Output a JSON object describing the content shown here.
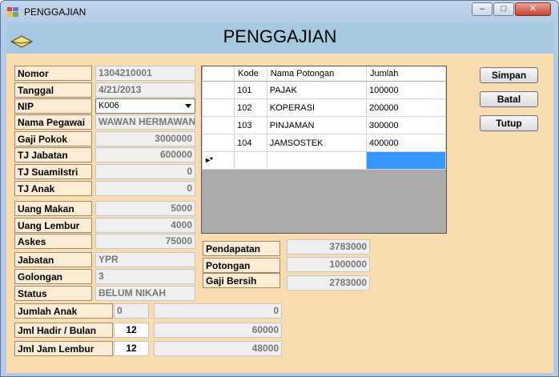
{
  "window": {
    "title": "PENGGAJIAN"
  },
  "form": {
    "heading": "PENGGAJIAN"
  },
  "fields": {
    "nomor": {
      "label": "Nomor",
      "value": "1304210001"
    },
    "tanggal": {
      "label": "Tanggal",
      "value": "4/21/2013"
    },
    "nip": {
      "label": "NIP",
      "value": "K006"
    },
    "nama_pegawai": {
      "label": "Nama Pegawai",
      "value": "WAWAN HERMAWAN"
    },
    "gaji_pokok": {
      "label": "Gaji Pokok",
      "value": "3000000"
    },
    "tj_jabatan": {
      "label": "TJ Jabatan",
      "value": "600000"
    },
    "tj_suamiistri": {
      "label": "TJ SuamiIstri",
      "value": "0"
    },
    "tj_anak": {
      "label": "TJ Anak",
      "value": "0"
    },
    "uang_makan": {
      "label": "Uang Makan",
      "value": "5000"
    },
    "uang_lembur": {
      "label": "Uang Lembur",
      "value": "4000"
    },
    "askes": {
      "label": "Askes",
      "value": "75000"
    },
    "jabatan": {
      "label": "Jabatan",
      "value": "YPR"
    },
    "golongan": {
      "label": "Golongan",
      "value": "3"
    },
    "status": {
      "label": "Status",
      "value": "BELUM NIKAH"
    },
    "jumlah_anak": {
      "label": "Jumlah Anak",
      "value": "0",
      "total": "0"
    },
    "jml_hadir": {
      "label": "Jml Hadir / Bulan",
      "value": "12",
      "total": "60000"
    },
    "jml_jam_lembur": {
      "label": "Jml Jam Lembur",
      "value": "12",
      "total": "48000"
    }
  },
  "summary": {
    "pendapatan": {
      "label": "Pendapatan",
      "value": "3783000"
    },
    "potongan": {
      "label": "Potongan",
      "value": "1000000"
    },
    "gaji_bersih": {
      "label": "Gaji Bersih",
      "value": "2783000"
    }
  },
  "grid": {
    "columns": [
      "Kode",
      "Nama Potongan",
      "Jumlah"
    ],
    "rows": [
      {
        "kode": "101",
        "nama": "PAJAK",
        "jumlah": "100000"
      },
      {
        "kode": "102",
        "nama": "KOPERASI",
        "jumlah": "200000"
      },
      {
        "kode": "103",
        "nama": "PINJAMAN",
        "jumlah": "300000"
      },
      {
        "kode": "104",
        "nama": "JAMSOSTEK",
        "jumlah": "400000"
      }
    ],
    "new_row_marker": "▸*"
  },
  "buttons": {
    "simpan": "Simpan",
    "batal": "Batal",
    "tutup": "Tutup"
  },
  "window_controls": {
    "minimize": "–",
    "maximize": "□",
    "close": "✕"
  },
  "colors": {
    "form_bg": "#fadcb0",
    "header_band": "#a6c9e2",
    "selection": "#3399ff"
  }
}
